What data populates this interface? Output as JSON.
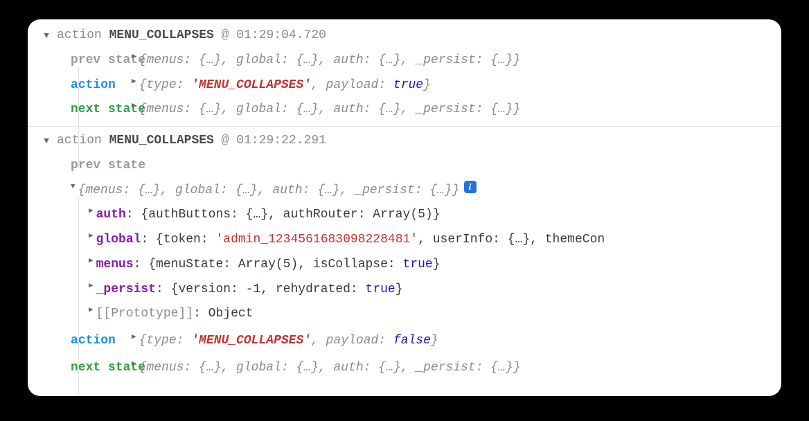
{
  "entries": {
    "e1": {
      "action_word": "action",
      "action_name": "MENU_COLLAPSES",
      "at": "@",
      "ts": "01:29:04.720",
      "prev_label": "prev state",
      "prev_summary": "{menus: {…}, global: {…}, auth: {…}, _persist: {…}}",
      "action_label": "action",
      "action_summary_pre": "{type: ",
      "action_type": "'MENU_COLLAPSES'",
      "action_summary_mid": ", payload: ",
      "action_payload": "true",
      "action_summary_post": "}",
      "next_label": "next state",
      "next_summary": "{menus: {…}, global: {…}, auth: {…}, _persist: {…}}"
    },
    "e2": {
      "action_word": "action",
      "action_name": "MENU_COLLAPSES",
      "at": "@",
      "ts": "01:29:22.291",
      "prev_label": "prev state",
      "prev_summary": "{menus: {…}, global: {…}, auth: {…}, _persist: {…}}",
      "auth_key": "auth",
      "auth_val": "{authButtons: {…}, authRouter: Array(5)}",
      "global_key": "global",
      "global_pre": "{token: ",
      "global_token": "'admin_1234561683098228481'",
      "global_mid": ", userInfo: {…}, themeCon",
      "menus_key": "menus",
      "menus_pre": "{menuState: Array(5), isCollapse: ",
      "menus_bool": "true",
      "menus_post": "}",
      "persist_key": "_persist",
      "persist_pre": "{version: ",
      "persist_num": "-1",
      "persist_mid": ", rehydrated: ",
      "persist_bool": "true",
      "persist_post": "}",
      "proto_key": "[[Prototype]]",
      "proto_val": "Object",
      "action_label": "action",
      "action_summary_pre": "{type: ",
      "action_type": "'MENU_COLLAPSES'",
      "action_summary_mid": ", payload: ",
      "action_payload": "false",
      "action_summary_post": "}",
      "next_label": "next state",
      "next_summary": "{menus: {…}, global: {…}, auth: {…}, _persist: {…}}"
    }
  },
  "info_badge": "i"
}
